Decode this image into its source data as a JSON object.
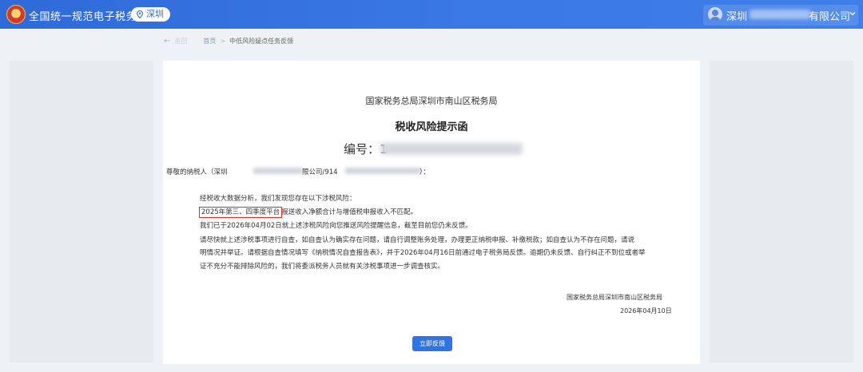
{
  "header": {
    "app_title": "全国统一规范电子税务局",
    "region": "深圳",
    "company_prefix": "深圳",
    "company_suffix": "有限公司"
  },
  "breadcrumb": {
    "back_label": "返回",
    "home": "首页",
    "separator": ">",
    "current": "中低风险疑点任务反馈"
  },
  "letter": {
    "issuer": "国家税务总局深圳市南山区税务局",
    "title": "税收风险提示函",
    "number_label": "编号：",
    "number_visible": "1",
    "salutation_prefix": "尊敬的纳税人（深圳",
    "salutation_mid": "限公司/914",
    "salutation_suffix": "）：",
    "intro": "经税收大数据分析，我们发现您存在以下涉税风险：",
    "risk_highlight": "2025年第三、四季度平台",
    "risk_rest": "报送收入净额合计与增值税申报收入不匹配。",
    "notice": "我们已于2026年04月02日就上述涉税风险向您推送风险提醒信息，截至目前您仍未反馈。",
    "request_line1": "请尽快就上述涉税事项进行自查，如自查认为确实存在问题，请自行调整账务处理，办理更正纳税申报、补缴税款；如自查认为不存在问题，请说",
    "request_line2": "明情况并举证。请根据自查情况填写《纳税情况自查报告表》，并于2026年04月16日前通过电子税务局反馈。逾期仍未反馈、自行纠正不到位或者举",
    "request_line3": "证不充分不能排除风险的，我们将委派税务人员就有关涉税事项进一步调查核实。",
    "sign_issuer": "国家税务总局深圳市南山区税务局",
    "sign_date": "2026年04月10日",
    "feedback_button": "立即反馈"
  },
  "colors": {
    "header_blue": "#2f6bd8",
    "button_blue": "#2f74e0",
    "highlight_red": "#d9342b"
  },
  "icons": [
    "emblem-icon",
    "location-pin-icon",
    "avatar-icon",
    "chevron-down-icon",
    "back-arrow-icon"
  ]
}
